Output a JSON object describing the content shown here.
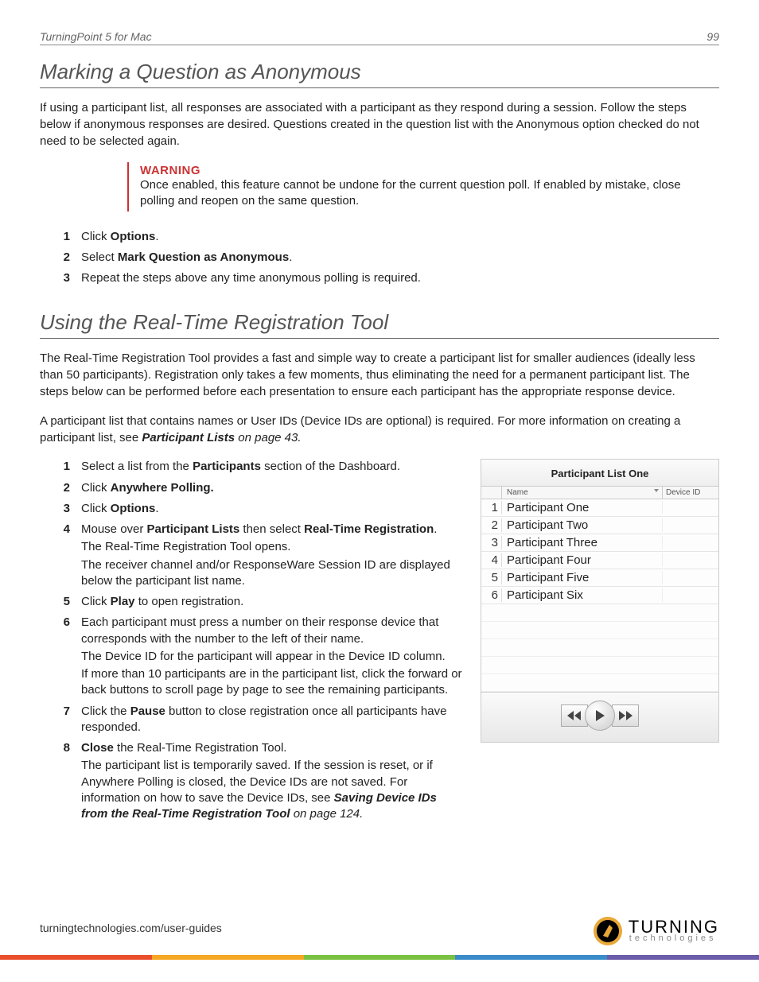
{
  "header": {
    "title": "TurningPoint 5 for Mac",
    "page_number": "99"
  },
  "section1": {
    "heading": "Marking a Question as Anonymous",
    "intro": "If using a participant list, all responses are associated with a participant as they respond during a session. Follow the steps below if anonymous responses are desired. Questions created in the question list with the Anonymous option checked do not need to be selected again.",
    "warning": {
      "label": "WARNING",
      "body": "Once enabled, this feature cannot be undone for the current question poll. If enabled by mistake, close polling and reopen on the same question."
    },
    "steps": [
      {
        "num": "1",
        "pre": "Click ",
        "bold": "Options",
        "post": "."
      },
      {
        "num": "2",
        "pre": "Select ",
        "bold": "Mark Question as Anonymous",
        "post": "."
      },
      {
        "num": "3",
        "text": "Repeat the steps above any time anonymous polling is required."
      }
    ]
  },
  "section2": {
    "heading": "Using the Real-Time Registration Tool",
    "p1": "The Real-Time Registration Tool provides a fast and simple way to create a participant list for smaller audiences (ideally less than 50 participants). Registration only takes a few moments, thus eliminating the need for a permanent participant list. The steps below can be performed before each presentation to ensure each participant has the appropriate response device.",
    "p2a": "A participant list that contains names or User IDs (Device IDs are optional) is required. For more information on creating a participant list, see ",
    "p2b": "Participant Lists",
    "p2c": " on page 43.",
    "steps": {
      "s1": {
        "num": "1",
        "t1": "Select a list from the ",
        "b1": "Participants",
        "t2": " section of the Dashboard."
      },
      "s2": {
        "num": "2",
        "t1": "Click ",
        "b1": "Anywhere Polling."
      },
      "s3": {
        "num": "3",
        "t1": "Click ",
        "b1": "Options",
        "t2": "."
      },
      "s4": {
        "num": "4",
        "t1": "Mouse over ",
        "b1": "Participant Lists",
        "t2": " then select ",
        "b2": "Real-Time Registration",
        "t3": ".",
        "sub1": "The Real-Time Registration Tool opens.",
        "sub2": "The receiver channel and/or ResponseWare Session ID are displayed below the participant list name."
      },
      "s5": {
        "num": "5",
        "t1": "Click ",
        "b1": "Play",
        "t2": " to open registration."
      },
      "s6": {
        "num": "6",
        "t1": "Each participant must press a number on their response device that corresponds with the number to the left of their name.",
        "sub1": "The Device ID for the participant will appear in the Device ID column.",
        "sub2": "If more than 10 participants are in the participant list, click the forward or back buttons to scroll page by page to see the remaining participants."
      },
      "s7": {
        "num": "7",
        "t1": "Click the ",
        "b1": "Pause",
        "t2": " button to close registration once all participants have responded."
      },
      "s8": {
        "num": "8",
        "b1": "Close",
        "t1": " the Real-Time Registration Tool.",
        "sub1a": "The participant list is temporarily saved. If the session is reset, or if Anywhere Polling is closed, the Device IDs are not saved. For information on how to save the Device IDs, see ",
        "sub1b": "Saving Device IDs from the Real-Time Registration Tool",
        "sub1c": " on page 124."
      }
    }
  },
  "figure": {
    "title": "Participant List One",
    "col_name": "Name",
    "col_device": "Device ID",
    "rows": [
      {
        "n": "1",
        "name": "Participant One"
      },
      {
        "n": "2",
        "name": "Participant Two"
      },
      {
        "n": "3",
        "name": "Participant Three"
      },
      {
        "n": "4",
        "name": "Participant Four"
      },
      {
        "n": "5",
        "name": "Participant Five"
      },
      {
        "n": "6",
        "name": "Participant Six"
      }
    ]
  },
  "footer": {
    "url": "turningtechnologies.com/user-guides",
    "logo_top": "TURNING",
    "logo_bottom": "technologies"
  }
}
